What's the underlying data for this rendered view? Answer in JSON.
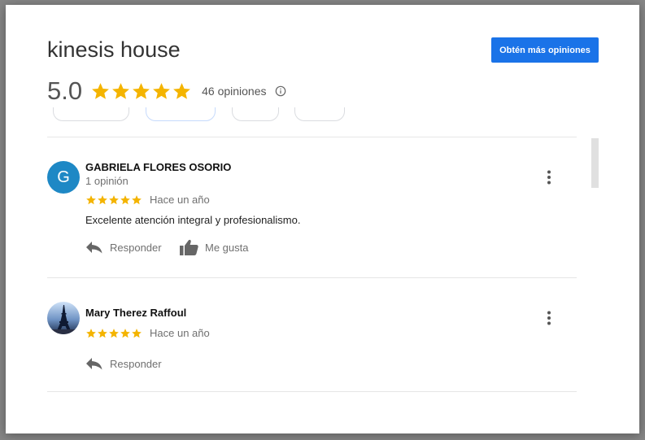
{
  "header": {
    "title": "kinesis house",
    "cta_label": "Obtén más opiniones",
    "rating": "5.0",
    "review_count": "46 opiniones"
  },
  "reviews": [
    {
      "avatar_letter": "G",
      "name": "GABRIELA FLORES OSORIO",
      "sub": "1 opinión",
      "stars": 5,
      "time": "Hace un año",
      "text": "Excelente atención integral y profesionalismo.",
      "reply_label": "Responder",
      "like_label": "Me gusta"
    },
    {
      "avatar_letter": "",
      "name": "Mary Therez Raffoul",
      "stars": 5,
      "time": "Hace un año",
      "reply_label": "Responder"
    }
  ],
  "colors": {
    "accent": "#1a73e8",
    "star": "#f4b400",
    "avatar_g": "#1e88c5"
  },
  "icons": [
    "info-icon",
    "reply-icon",
    "thumbs-up-icon",
    "more-vert-icon",
    "star-icon"
  ]
}
